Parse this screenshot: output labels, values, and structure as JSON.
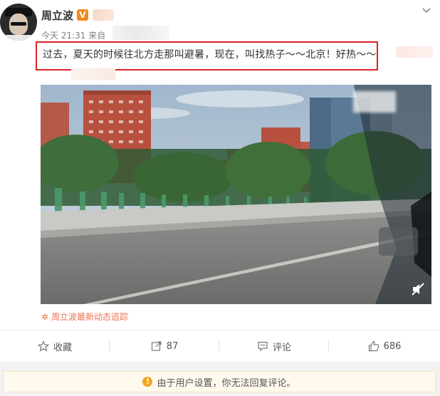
{
  "post": {
    "author": "周立波",
    "verified_badge": "V",
    "timestamp": "今天 21:31",
    "source_prefix": "来自",
    "text": "过去，夏天的时候往北方走那叫避暑，现在，叫找热子～～北京！好热～～",
    "video_source": "周立波最新动态追踪"
  },
  "actions": {
    "favorite_label": "收藏",
    "repost_count": "87",
    "comment_label": "评论",
    "like_count": "686"
  },
  "notice": {
    "icon": "!",
    "text": "由于用户设置，你无法回复评论。"
  },
  "colors": {
    "highlight_border": "#d9222a",
    "source_link": "#eb7350",
    "verified_badge": "#f28a1c",
    "notice_icon": "#f5a623"
  },
  "icons": [
    "chevron-down-icon",
    "mute-icon",
    "star-icon",
    "repost-icon",
    "comment-icon",
    "like-icon",
    "warning-icon"
  ]
}
